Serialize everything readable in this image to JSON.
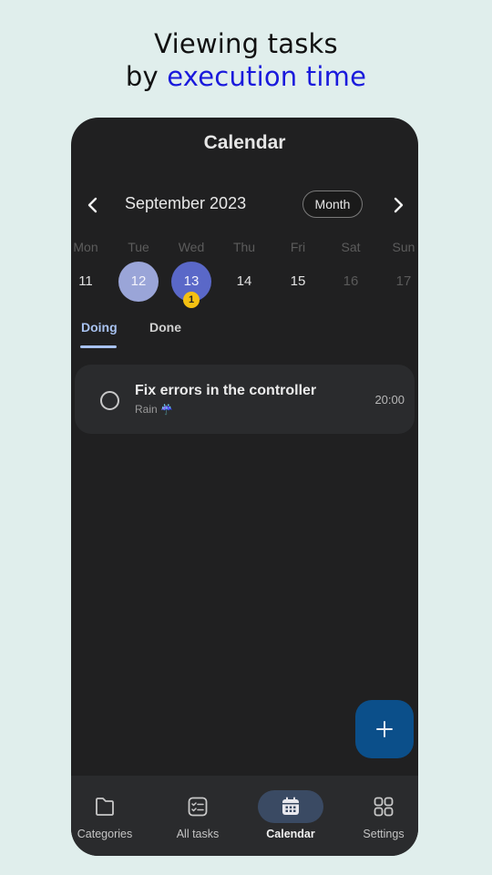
{
  "headline": {
    "line1": "Viewing tasks",
    "line2_prefix": "by ",
    "line2_accent": "execution time"
  },
  "app": {
    "title": "Calendar",
    "month_label": "September 2023",
    "view_mode": "Month",
    "weekdays": [
      "Mon",
      "Tue",
      "Wed",
      "Thu",
      "Fri",
      "Sat",
      "Sun"
    ],
    "days": [
      "11",
      "12",
      "13",
      "14",
      "15",
      "16",
      "17"
    ],
    "today": "12",
    "selected": "13",
    "badge_count": "1",
    "tabs": [
      "Doing",
      "Done"
    ],
    "active_tab": "Doing",
    "tasks": [
      {
        "title": "Fix errors in the controller",
        "subtitle": "Rain",
        "weather_icon": "umbrella-rain-icon",
        "time": "20:00"
      }
    ],
    "fab_icon": "plus-icon",
    "nav": [
      {
        "label": "Categories",
        "icon": "folder-icon"
      },
      {
        "label": "All tasks",
        "icon": "checklist-icon"
      },
      {
        "label": "Calendar",
        "icon": "calendar-icon",
        "active": true
      },
      {
        "label": "Settings",
        "icon": "grid-icon"
      }
    ]
  },
  "colors": {
    "background": "#e0eeec",
    "accent_text": "#1a1adc",
    "app_bg": "#202021",
    "today_circle": "#9aa5d8",
    "selected_circle": "#5a68c8",
    "badge": "#f4c012",
    "tab_active": "#a8c2f0",
    "fab": "#0b4f8a",
    "nav_active_pill": "#3a4a63"
  }
}
